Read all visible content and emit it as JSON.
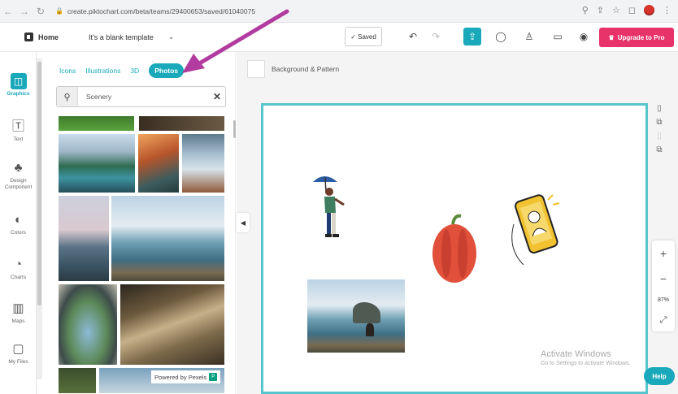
{
  "browser": {
    "url": "create.piktochart.com/beta/teams/29400653/saved/61040075"
  },
  "header": {
    "home_label": "Home",
    "template_name": "It's a blank template",
    "saved_label": "✓ Saved",
    "upgrade_label": "Upgrade to Pro"
  },
  "rail": {
    "items": [
      {
        "label": "Graphics",
        "icon": "graphics-icon"
      },
      {
        "label": "Text",
        "icon": "text-icon"
      },
      {
        "label": "Design Component",
        "icon": "design-component-icon"
      },
      {
        "label": "Colors",
        "icon": "palette-icon"
      },
      {
        "label": "Charts",
        "icon": "chart-icon"
      },
      {
        "label": "Maps",
        "icon": "map-icon"
      },
      {
        "label": "My Files",
        "icon": "folder-icon"
      }
    ]
  },
  "panel": {
    "tabs": [
      "Icons",
      "Illustrations",
      "3D",
      "Photos"
    ],
    "active_tab": "Photos",
    "search_value": "Scenery",
    "powered_by": "Powered by Pexels"
  },
  "canvas": {
    "background_label": "Background & Pattern",
    "zoom": "87%"
  },
  "help_label": "Help",
  "watermark": {
    "title": "Activate Windows",
    "subtitle": "Go to Settings to activate Windows."
  },
  "colors": {
    "accent": "#19a9ba",
    "upgrade": "#e8336a",
    "canvas_border": "#57c5cc",
    "arrow": "#b13b9e"
  }
}
